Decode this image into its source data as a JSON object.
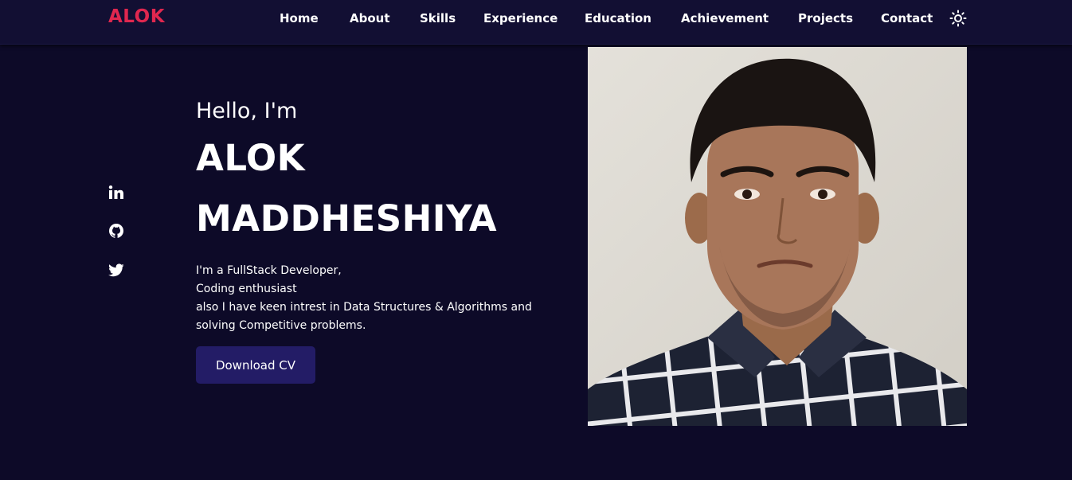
{
  "brand": {
    "logo": "ALOK",
    "accent_color": "#e0274f"
  },
  "nav": {
    "items": [
      {
        "label": "Home"
      },
      {
        "label": "About"
      },
      {
        "label": "Skills"
      },
      {
        "label": "Experience"
      },
      {
        "label": "Education"
      },
      {
        "label": "Achievement"
      },
      {
        "label": "Projects"
      },
      {
        "label": "Contact"
      }
    ],
    "theme_toggle_icon": "sun-icon"
  },
  "social": [
    {
      "icon": "linkedin-icon"
    },
    {
      "icon": "github-icon"
    },
    {
      "icon": "twitter-icon"
    }
  ],
  "hero": {
    "greeting": "Hello, I'm",
    "first_name": "ALOK",
    "last_name": "MADDHESHIYA",
    "bio_lines": [
      "I'm a FullStack Developer,",
      "Coding enthusiast",
      "also I have keen intrest in Data Structures & Algorithms and",
      "solving Competitive problems."
    ],
    "cta_label": "Download CV"
  },
  "colors": {
    "background": "#0d0a28",
    "navbar": "#120f33",
    "button": "#231c66"
  }
}
